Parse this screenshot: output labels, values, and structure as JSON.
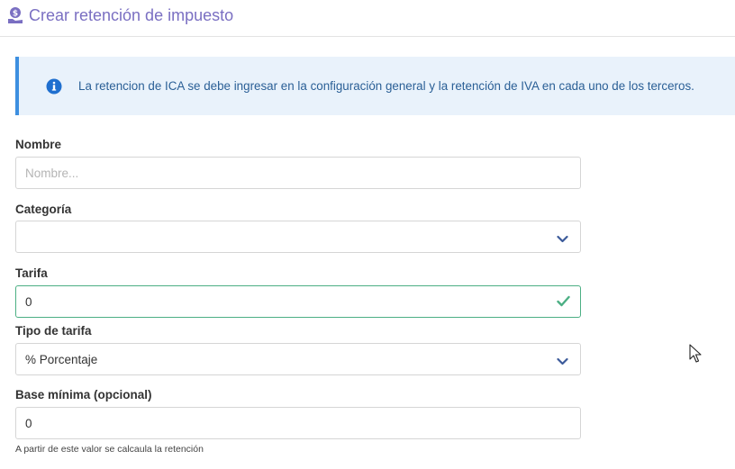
{
  "header": {
    "title": "Crear retención de impuesto",
    "icon": "money-hand-icon",
    "accent_color": "#7a6fc2"
  },
  "alert": {
    "icon": "info-icon",
    "text": "La retencion de ICA se debe ingresar en la configuración general y la retención de IVA en cada uno de los terceros.",
    "color": "#2a5f96"
  },
  "form": {
    "nombre": {
      "label": "Nombre",
      "placeholder": "Nombre...",
      "value": ""
    },
    "categoria": {
      "label": "Categoría",
      "value": "",
      "icon": "chevron-down-icon"
    },
    "tarifa": {
      "label": "Tarifa",
      "value": "0",
      "icon": "check-icon",
      "status_color": "#4caf84"
    },
    "tipo_tarifa": {
      "label": "Tipo de tarifa",
      "value": "% Porcentaje",
      "icon": "chevron-down-icon"
    },
    "base_minima": {
      "label": "Base mínima (opcional)",
      "value": "0",
      "help": "A partir de este valor se calcaula la retención"
    }
  }
}
